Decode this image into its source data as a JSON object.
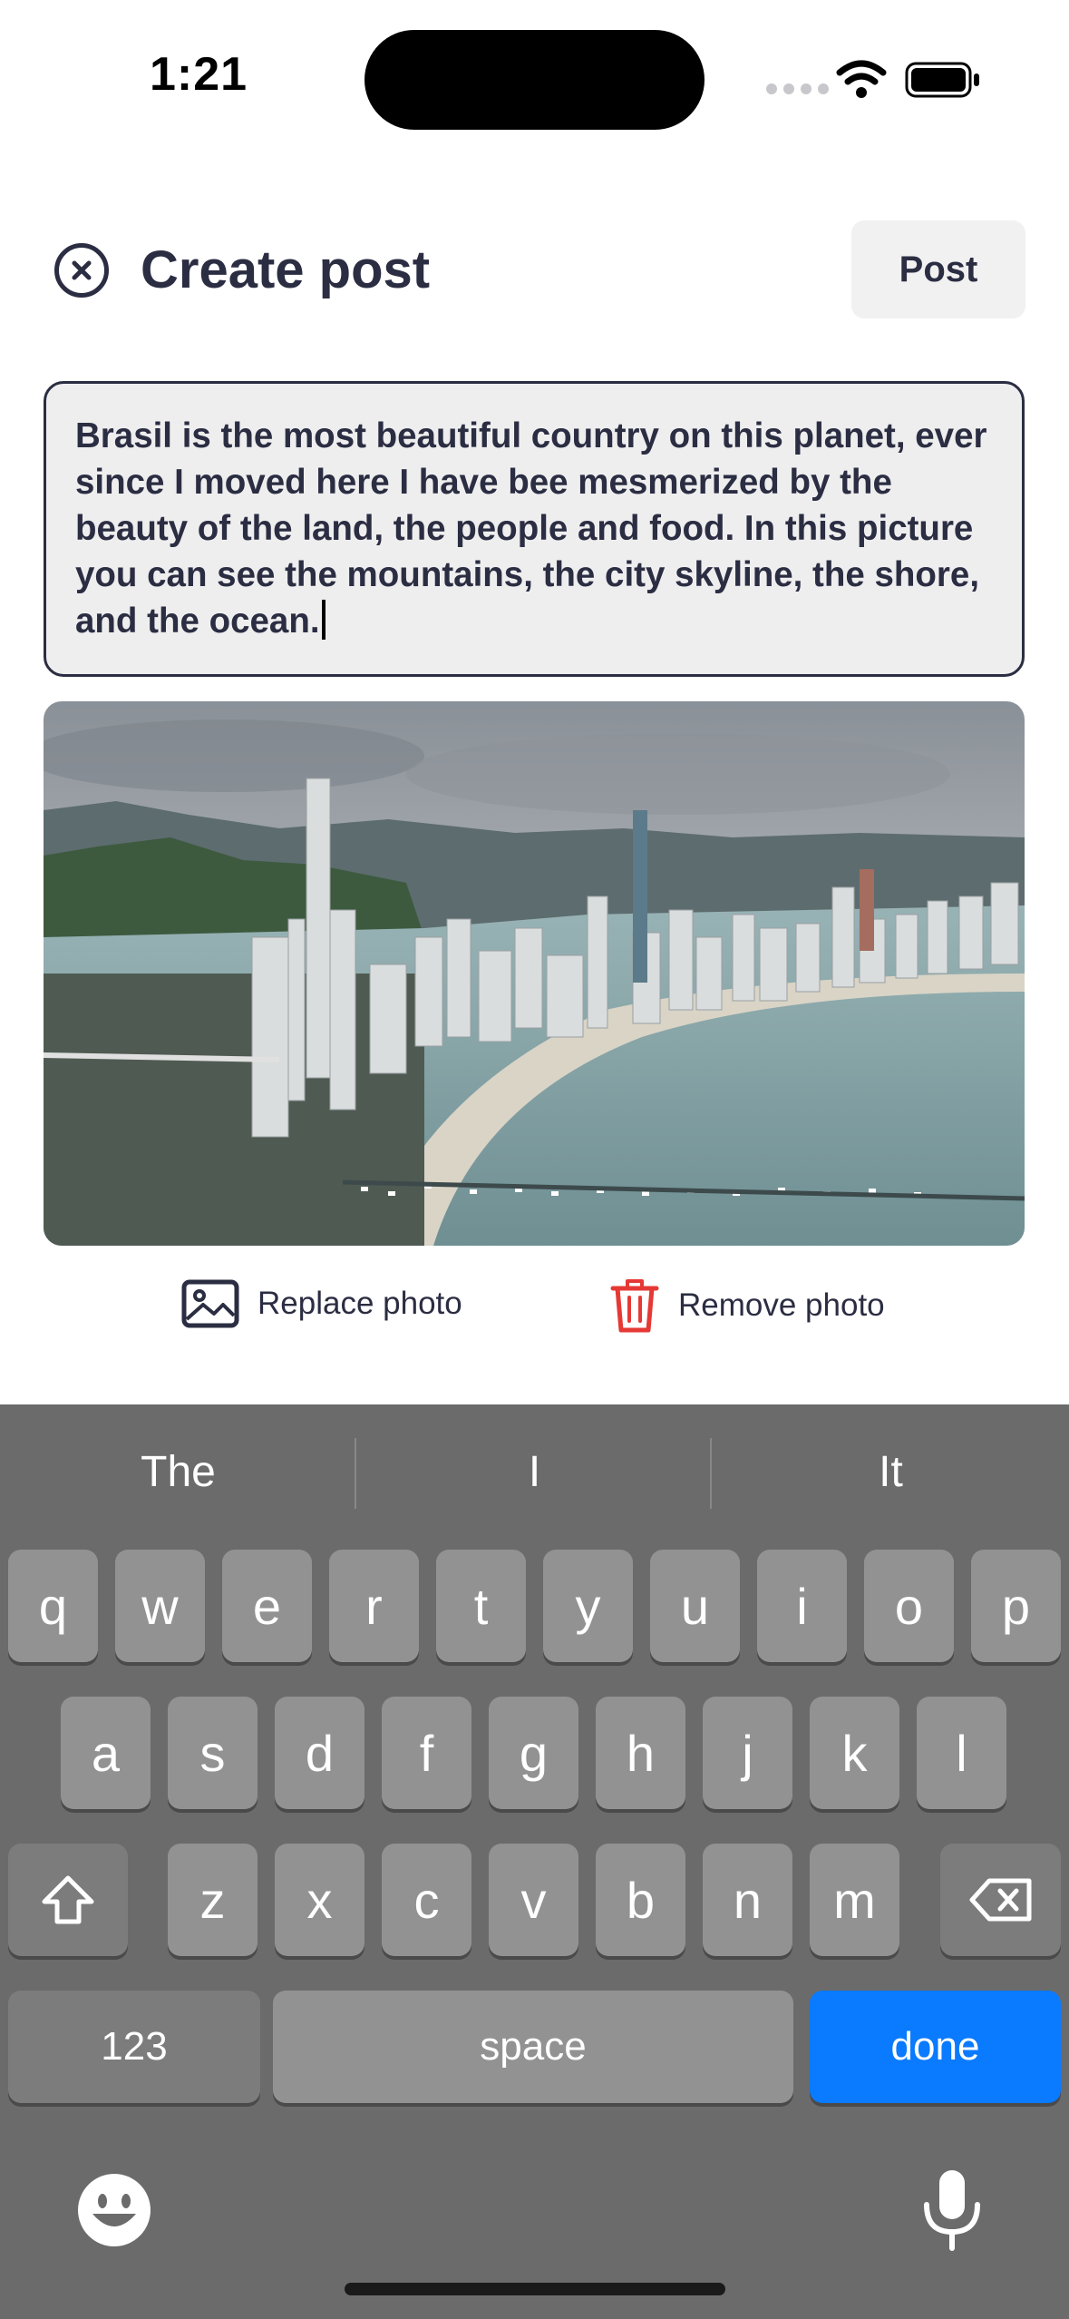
{
  "status_bar": {
    "time": "1:21"
  },
  "header": {
    "title": "Create post",
    "post_label": "Post"
  },
  "post_text": "Brasil is the most beautiful country on this planet, ever since I moved here I have bee mesmerized by the beauty of the land, the people and food. In this picture you can see the mountains, the city skyline, the shore, and the ocean.",
  "photo_actions": {
    "replace_label": "Replace photo",
    "remove_label": "Remove photo",
    "remove_color": "#e53935"
  },
  "keyboard": {
    "suggestions": [
      "The",
      "I",
      "It"
    ],
    "row1": [
      "q",
      "w",
      "e",
      "r",
      "t",
      "y",
      "u",
      "i",
      "o",
      "p"
    ],
    "row2": [
      "a",
      "s",
      "d",
      "f",
      "g",
      "h",
      "j",
      "k",
      "l"
    ],
    "row3": [
      "z",
      "x",
      "c",
      "v",
      "b",
      "n",
      "m"
    ],
    "numbers_label": "123",
    "space_label": "space",
    "done_label": "done",
    "done_color": "#0a7aff"
  }
}
